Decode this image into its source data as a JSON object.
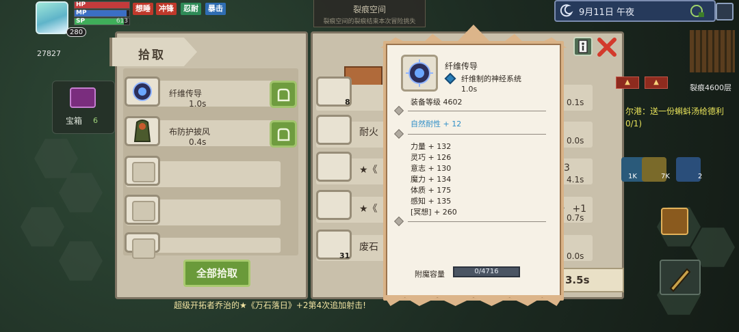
{
  "hud": {
    "level": "280",
    "hp_label": "HP",
    "mp_label": "MP",
    "sp_label": "SP",
    "sp_value": "613",
    "hp_fill": 1.0,
    "mp_fill": 0.95,
    "sp_fill": 0.9,
    "statuses": [
      {
        "label": "想睡",
        "color": "#c0392b"
      },
      {
        "label": "冲锋",
        "color": "#c0392b"
      },
      {
        "label": "忍耐",
        "color": "#2e8b57"
      },
      {
        "label": "暴击",
        "color": "#2f6db2"
      }
    ],
    "counter": "27827"
  },
  "rift": {
    "title": "裂痕空间",
    "subtitle": "裂痕空间的裂痕结束本次冒险挑失"
  },
  "clock": {
    "text": "9月11日 午夜"
  },
  "floor": {
    "label": "裂痕4600层"
  },
  "chest": {
    "label": "宝箱",
    "count": "6"
  },
  "loot_panel": {
    "title": "拾取",
    "items": [
      {
        "name": "纤维传导",
        "time": "1.0s"
      },
      {
        "name": "布防护披风",
        "time": "0.4s"
      }
    ],
    "pick_all_label": "全部拾取"
  },
  "list_panel": {
    "rows": [
      {
        "name": "",
        "time": "0.1s",
        "qty": "8"
      },
      {
        "name": "耐火",
        "time": "0.0s",
        "qty": ""
      },
      {
        "name": "★《",
        "time": "4.1s",
        "qty": "",
        "suffix": "3"
      },
      {
        "name": "★《",
        "time": "0.7s",
        "qty": "",
        "suffix": "》 +1"
      },
      {
        "name": "废石",
        "time": "0.0s",
        "qty": "31"
      }
    ],
    "total_time": "3.5s"
  },
  "right_hud": {
    "counts": [
      "1K",
      "7K",
      "2"
    ],
    "tip_text": "尔港：送一份蝌蚪汤给德利",
    "tip_sub": "0/1)"
  },
  "bottom_message": "超级开拓者乔治的★《万石落日》+2第4次追加射击!",
  "tooltip": {
    "name": "纤维传导",
    "desc": "纤维制的神经系统",
    "time": "1.0s",
    "equip_level": "装备等级 4602",
    "resist": "自然耐性 + 12",
    "stats": [
      "力量 + 132",
      "灵巧 + 126",
      "意志 + 130",
      "魔力 + 134",
      "体质 + 175",
      "感知 + 135",
      "[冥想] + 260"
    ],
    "enchant_label": "附魔容量",
    "enchant_value": "0/4716"
  },
  "colors": {
    "accent_green": "#6f9c3f",
    "panel": "#c9c0ab",
    "tooltip_border": "#d9b286",
    "resist_blue": "#2e8ec7"
  }
}
